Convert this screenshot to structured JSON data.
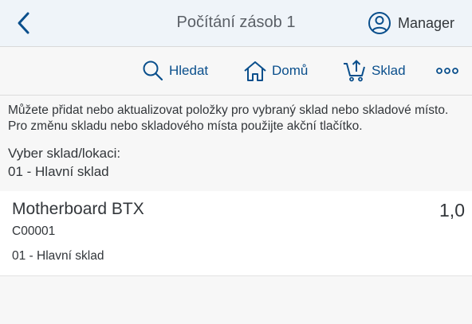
{
  "header": {
    "title": "Počítání zásob 1",
    "user_label": "Manager"
  },
  "toolbar": {
    "search_label": "Hledat",
    "home_label": "Domů",
    "warehouse_label": "Sklad"
  },
  "info": {
    "text": "Můžete přidat nebo aktualizovat položky pro vybraný sklad nebo skladové místo. Pro změnu skladu nebo skladového místa použijte akční tlačítko.",
    "select_label": "Vyber sklad/lokaci:",
    "select_value": "01 - Hlavní sklad"
  },
  "items": [
    {
      "name": "Motherboard BTX",
      "code": "C00001",
      "location": "01 - Hlavní sklad",
      "quantity": "1,0"
    }
  ],
  "colors": {
    "accent": "#0a4f8c",
    "header_bg": "#eff4f9",
    "page_bg": "#f7f7f7"
  },
  "icons": [
    "chevron-left-icon",
    "user-circle-icon",
    "search-icon",
    "home-icon",
    "cart-upload-icon",
    "more-icon"
  ]
}
